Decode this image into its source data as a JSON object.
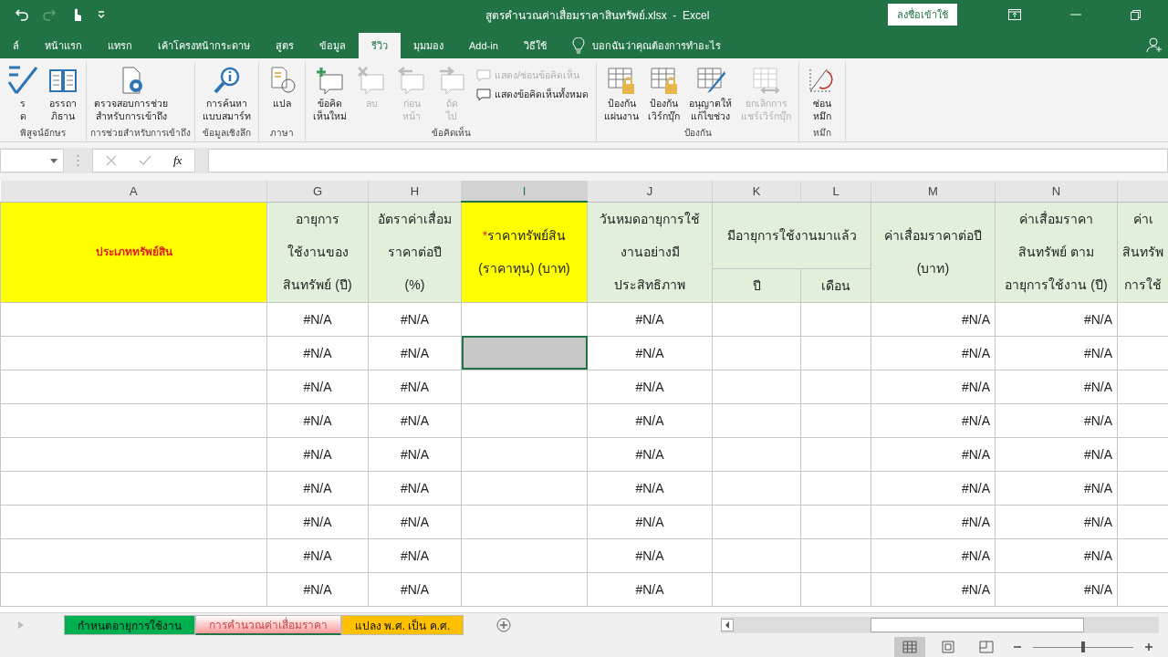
{
  "title_bar": {
    "title": "สูตรคำนวณค่าเสื่อมราคาสินทรัพย์.xlsx  -  Excel",
    "sign_in": "ลงชื่อเข้าใช้"
  },
  "ribbon_tabs": [
    {
      "label": "ล์",
      "selected": false
    },
    {
      "label": "หน้าแรก",
      "selected": false
    },
    {
      "label": "แทรก",
      "selected": false
    },
    {
      "label": "เค้าโครงหน้ากระดาษ",
      "selected": false
    },
    {
      "label": "สูตร",
      "selected": false
    },
    {
      "label": "ข้อมูล",
      "selected": false
    },
    {
      "label": "รีวิว",
      "selected": true
    },
    {
      "label": "มุมมอง",
      "selected": false
    },
    {
      "label": "Add-in",
      "selected": false
    },
    {
      "label": "วิธีใช้",
      "selected": false
    }
  ],
  "tell_me": "บอกฉันว่าคุณต้องการทำอะไร",
  "ribbon_groups": [
    {
      "label": "พิสูจน์อักษร",
      "buttons": [
        {
          "lines": [
            "ร",
            "ด"
          ],
          "disabled": false
        },
        {
          "lines": [
            "อรรถา",
            "ภิธาน"
          ],
          "disabled": false
        }
      ]
    },
    {
      "label": "การช่วยสำหรับการเข้าถึง",
      "buttons": [
        {
          "lines": [
            "ตรวจสอบการช่วย",
            "สำหรับการเข้าถึง"
          ],
          "disabled": false
        }
      ]
    },
    {
      "label": "ข้อมูลเชิงลึก",
      "buttons": [
        {
          "lines": [
            "การค้นหา",
            "แบบสมาร์ท"
          ],
          "disabled": false
        }
      ]
    },
    {
      "label": "ภาษา",
      "buttons": [
        {
          "lines": [
            "แปล"
          ],
          "disabled": false
        }
      ]
    },
    {
      "label": "ข้อคิดเห็น",
      "buttons": [
        {
          "lines": [
            "ข้อคิด",
            "เห็นใหม่"
          ],
          "disabled": false
        },
        {
          "lines": [
            "ลบ"
          ],
          "disabled": true
        },
        {
          "lines": [
            "ก่อน",
            "หน้า"
          ],
          "disabled": true
        },
        {
          "lines": [
            "ถัด",
            "ไป"
          ],
          "disabled": true
        }
      ],
      "small_buttons": [
        {
          "label": "แสดง/ซ่อนข้อคิดเห็น",
          "disabled": true
        },
        {
          "label": "แสดงข้อคิดเห็นทั้งหมด",
          "disabled": false
        }
      ]
    },
    {
      "label": "ป้องกัน",
      "buttons": [
        {
          "lines": [
            "ป้องกัน",
            "แผ่นงาน"
          ],
          "disabled": false
        },
        {
          "lines": [
            "ป้องกัน",
            "เวิร์กบุ๊ก"
          ],
          "disabled": false
        },
        {
          "lines": [
            "อนุญาตให้",
            "แก้ไขช่วง"
          ],
          "disabled": false
        },
        {
          "lines": [
            "ยกเลิกการ",
            "แชร์เวิร์กบุ๊ก"
          ],
          "disabled": true
        }
      ]
    },
    {
      "label": "หมึก",
      "buttons": [
        {
          "lines": [
            "ซ่อน",
            "หมึก"
          ],
          "disabled": false
        }
      ]
    }
  ],
  "formula_bar": {
    "function_label": "fx"
  },
  "columns": [
    {
      "letter": "A",
      "selected": false,
      "color": "#ffff00",
      "kind": "title",
      "lines": [
        "ประเภททรัพย์สิน"
      ]
    },
    {
      "letter": "G",
      "selected": false,
      "color": "#e2efda",
      "kind": "normal",
      "lines": [
        "อายุการ",
        "ใช้งานของ",
        "สินทรัพย์ (ปี)"
      ]
    },
    {
      "letter": "H",
      "selected": false,
      "color": "#e2efda",
      "kind": "normal",
      "lines": [
        "อัตราค่าเสื่อม",
        "ราคาต่อปี",
        "(%)"
      ]
    },
    {
      "letter": "I",
      "selected": true,
      "color": "#ffff00",
      "kind": "required",
      "mark": "*",
      "lines": [
        "ราคาทรัพย์สิน",
        "(ราคาทุน) (บาท)"
      ]
    },
    {
      "letter": "J",
      "selected": false,
      "color": "#e2efda",
      "kind": "normal",
      "lines": [
        "วันหมดอายุการใช้",
        "งานอย่างมี",
        "ประสิทธิภาพ"
      ]
    },
    {
      "letter": "K",
      "selected": false,
      "color": "#e2efda",
      "kind": "group",
      "group_lines": [
        "มีอายุการใช้งานมาแล้ว"
      ],
      "sub": "ปี"
    },
    {
      "letter": "L",
      "selected": false,
      "color": "#e2efda",
      "kind": "sub",
      "sub": "เดือน"
    },
    {
      "letter": "M",
      "selected": false,
      "color": "#e2efda",
      "kind": "normal",
      "lines": [
        "ค่าเสื่อมราคาต่อปี",
        "(บาท)"
      ]
    },
    {
      "letter": "N",
      "selected": false,
      "color": "#e2efda",
      "kind": "normal",
      "lines": [
        "ค่าเสื่อมราคา",
        "สินทรัพย์ ตาม",
        "อายุการใช้งาน (ปี)"
      ]
    },
    {
      "selected": false,
      "color": "#e2efda",
      "kind": "normal",
      "lines": [
        "ค่าเ",
        "สินทรัพ",
        "การใช้"
      ]
    }
  ],
  "rows": [
    {
      "selected": false,
      "cells": [
        "",
        "#N/A",
        "#N/A",
        "",
        "#N/A",
        "",
        "",
        "#N/A",
        "#N/A",
        ""
      ]
    },
    {
      "selected": true,
      "cells": [
        "",
        "#N/A",
        "#N/A",
        "",
        "#N/A",
        "",
        "",
        "#N/A",
        "#N/A",
        ""
      ]
    },
    {
      "selected": false,
      "cells": [
        "",
        "#N/A",
        "#N/A",
        "",
        "#N/A",
        "",
        "",
        "#N/A",
        "#N/A",
        ""
      ]
    },
    {
      "selected": false,
      "cells": [
        "",
        "#N/A",
        "#N/A",
        "",
        "#N/A",
        "",
        "",
        "#N/A",
        "#N/A",
        ""
      ]
    },
    {
      "selected": false,
      "cells": [
        "",
        "#N/A",
        "#N/A",
        "",
        "#N/A",
        "",
        "",
        "#N/A",
        "#N/A",
        ""
      ]
    },
    {
      "selected": false,
      "cells": [
        "",
        "#N/A",
        "#N/A",
        "",
        "#N/A",
        "",
        "",
        "#N/A",
        "#N/A",
        ""
      ]
    },
    {
      "selected": false,
      "cells": [
        "",
        "#N/A",
        "#N/A",
        "",
        "#N/A",
        "",
        "",
        "#N/A",
        "#N/A",
        ""
      ]
    },
    {
      "selected": false,
      "cells": [
        "",
        "#N/A",
        "#N/A",
        "",
        "#N/A",
        "",
        "",
        "#N/A",
        "#N/A",
        ""
      ]
    },
    {
      "selected": false,
      "cells": [
        "",
        "#N/A",
        "#N/A",
        "",
        "#N/A",
        "",
        "",
        "#N/A",
        "#N/A",
        ""
      ]
    }
  ],
  "sheet_tabs": [
    {
      "label": "กำหนดอายุการใช้งาน",
      "selected": false,
      "color": "#00b050"
    },
    {
      "label": "การคำนวณค่าเสื่อมราคา",
      "selected": true,
      "color": "#ff9999"
    },
    {
      "label": "แปลง พ.ศ. เป็น ค.ศ.",
      "selected": false,
      "color": "#ffc000"
    }
  ],
  "status_bar": {
    "views": [
      {
        "kind": "normal",
        "selected": true
      },
      {
        "kind": "page-layout",
        "selected": false
      },
      {
        "kind": "page-break",
        "selected": false
      }
    ],
    "zoom": {
      "level": 0.5
    }
  }
}
